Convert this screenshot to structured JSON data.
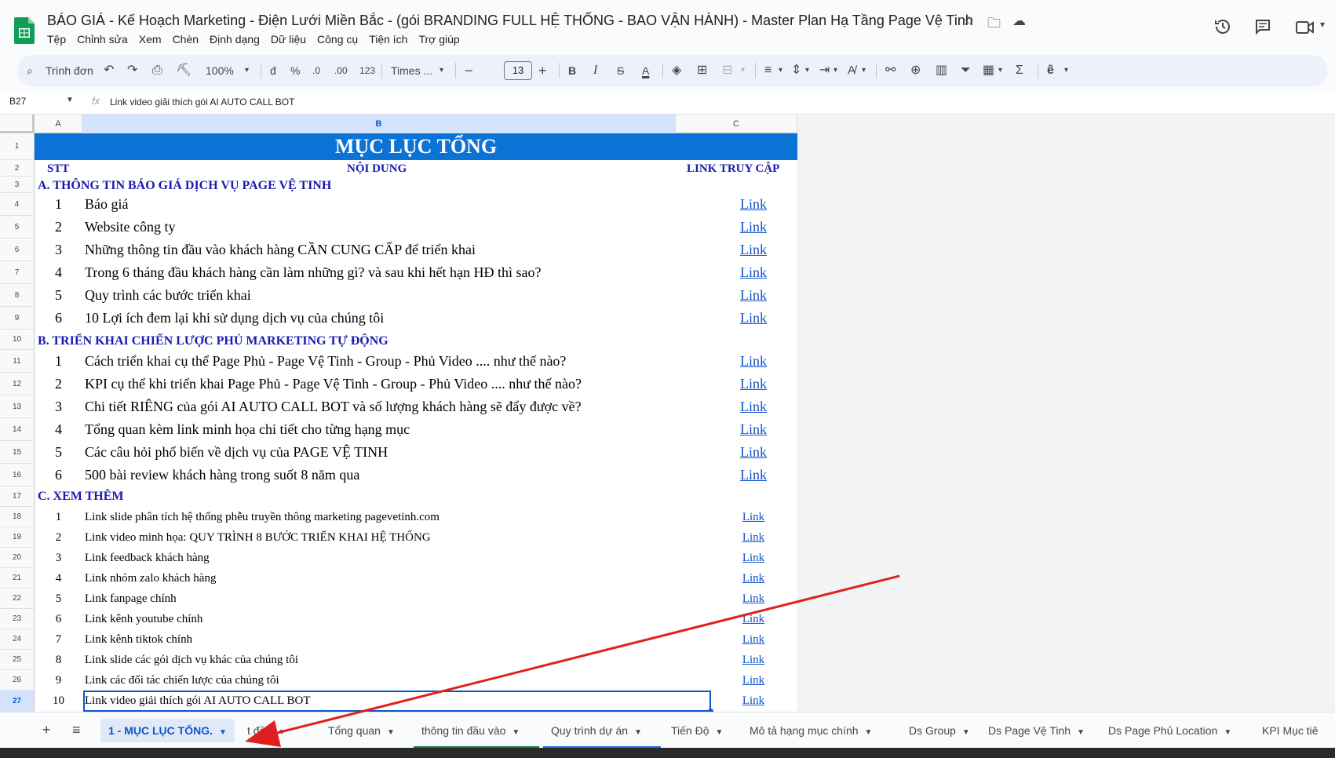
{
  "document": {
    "title": "BÁO GIÁ - Kế Hoạch Marketing - Điện Lưới Miền Bắc - (gói BRANDING FULL HỆ THỐNG - BAO VẬN HÀNH) -  Master Plan Hạ Tầng Page Vệ Tinh"
  },
  "menu": [
    "Tệp",
    "Chỉnh sửa",
    "Xem",
    "Chèn",
    "Định dạng",
    "Dữ liệu",
    "Công cụ",
    "Tiện ích",
    "Trợ giúp"
  ],
  "toolbar": {
    "search_label": "Trình đơn",
    "zoom": "100%",
    "currency": "đ",
    "percent": "%",
    "dec_decrease": ".0",
    "dec_increase": ".00",
    "number_format": "123",
    "font": "Times ...",
    "font_size": "13"
  },
  "formula_bar": {
    "cell_ref": "B27",
    "content": "Link video giải thích gói AI AUTO CALL BOT"
  },
  "columns": [
    "A",
    "B",
    "C"
  ],
  "sheet": {
    "banner": "MỤC LỤC TỔNG",
    "header_stt": "STT",
    "header_content": "NỘI DUNG",
    "header_link": "LINK TRUY CẬP",
    "section_a": "A. THÔNG TIN BÁO GIÁ DỊCH VỤ PAGE VỆ TINH",
    "section_b": "B. TRIỂN KHAI CHIẾN LƯỢC PHỦ MARKETING TỰ ĐỘNG",
    "section_c": "C. XEM THÊM",
    "rows_a": [
      {
        "stt": "1",
        "text": "Báo giá",
        "link": "Link"
      },
      {
        "stt": "2",
        "text": "Website công ty",
        "link": "Link"
      },
      {
        "stt": "3",
        "text": "Những thông tin đầu vào khách hàng CẦN CUNG CẤP để triển khai",
        "link": "Link"
      },
      {
        "stt": "4",
        "text": "Trong 6 tháng đầu khách hàng cần làm những gì? và sau khi hết hạn HĐ thì sao?",
        "link": "Link"
      },
      {
        "stt": "5",
        "text": "Quy trình các bước triển khai",
        "link": "Link"
      },
      {
        "stt": "6",
        "text": "10 Lợi ích đem lại khi sử dụng dịch vụ của chúng tôi",
        "link": "Link"
      }
    ],
    "rows_b": [
      {
        "stt": "1",
        "text": "Cách triển khai cụ thể Page Phủ - Page Vệ Tinh - Group - Phủ Video .... như thế nào?",
        "link": "Link"
      },
      {
        "stt": "2",
        "text": "KPI cụ thể khi triển khai Page Phủ - Page Vệ Tinh - Group - Phủ Video .... như thế nào?",
        "link": "Link"
      },
      {
        "stt": "3",
        "text": "Chi tiết RIÊNG của gói AI AUTO CALL BOT và số lượng khách hàng sẽ đẩy được về?",
        "link": "Link"
      },
      {
        "stt": "4",
        "text": "Tổng quan kèm link minh họa chi tiết cho từng hạng mục",
        "link": "Link"
      },
      {
        "stt": "5",
        "text": "Các câu hỏi phổ biến về dịch vụ của PAGE VỆ TINH",
        "link": "Link"
      },
      {
        "stt": "6",
        "text": "500 bài review khách hàng trong suốt 8 năm qua",
        "link": "Link"
      }
    ],
    "rows_c": [
      {
        "stt": "1",
        "text": "Link slide phân tích hệ thống phễu truyền thông marketing pagevetinh.com",
        "link": "Link"
      },
      {
        "stt": "2",
        "text": "Link video minh họa:  QUY TRÌNH 8 BƯỚC TRIỂN KHAI HỆ THỐNG",
        "link": "Link"
      },
      {
        "stt": "3",
        "text": "Link feedback khách hàng",
        "link": "Link"
      },
      {
        "stt": "4",
        "text": "Link nhóm zalo khách hàng",
        "link": "Link"
      },
      {
        "stt": "5",
        "text": "Link fanpage chính",
        "link": "Link"
      },
      {
        "stt": "6",
        "text": "Link kênh youtube chính",
        "link": "Link"
      },
      {
        "stt": "7",
        "text": "Link kênh tiktok chính",
        "link": "Link"
      },
      {
        "stt": "8",
        "text": "Link slide các gói dịch vụ khác của chúng tôi",
        "link": "Link"
      },
      {
        "stt": "9",
        "text": "Link các đối tác chiến lược của chúng tôi",
        "link": "Link"
      },
      {
        "stt": "10",
        "text": "Link video giải thích gói AI AUTO CALL BOT",
        "link": "Link"
      }
    ]
  },
  "tabs": [
    "1 - MỤC LỤC TỔNG.",
    "t đầu",
    "Tổng quan",
    "thông tin đầu vào",
    "Quy trình dự án",
    "Tiến Độ",
    "Mô tả hạng mục chính",
    "Ds Group",
    "Ds Page Vệ Tinh",
    "Ds Page Phủ Location",
    "KPI Mục tiê"
  ],
  "colors": {
    "banner": "#0b72d6",
    "section_text": "#1a1ab0",
    "link": "#1155cc",
    "selection": "#0b57d0",
    "annotation_arrow": "#e02020",
    "tab_underline_green": "#188038",
    "tab_underline_blue": "#1a73e8"
  }
}
